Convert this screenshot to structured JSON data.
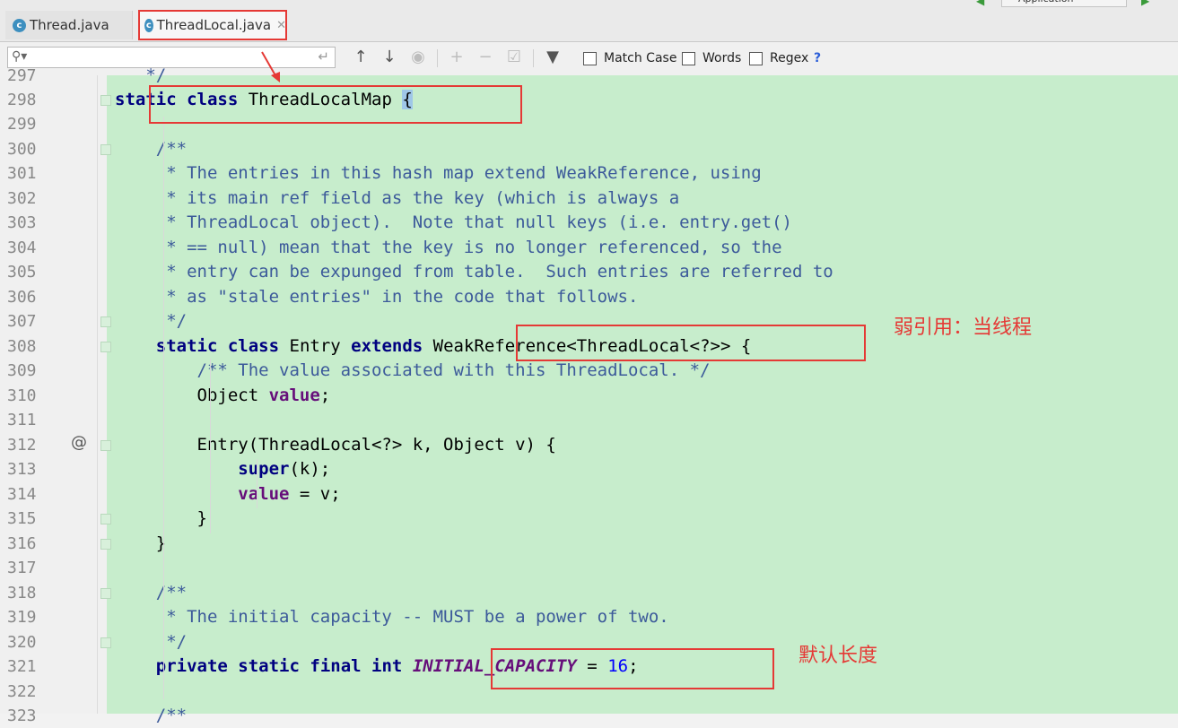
{
  "tabs": [
    {
      "label": "Thread.java",
      "icon": "c"
    },
    {
      "label": "ThreadLocal.java",
      "icon": "c"
    }
  ],
  "top_strip": {
    "label": "Application"
  },
  "find_bar": {
    "search_value": "",
    "options": [
      {
        "label": "Match Case",
        "checked": false
      },
      {
        "label": "Words",
        "checked": false
      },
      {
        "label": "Regex",
        "checked": false
      }
    ],
    "help": "?"
  },
  "code_lines": [
    {
      "n": "297",
      "text": "   */"
    },
    {
      "n": "298",
      "text": "static class ThreadLocalMap {"
    },
    {
      "n": "299",
      "text": ""
    },
    {
      "n": "300",
      "text": "    /**"
    },
    {
      "n": "301",
      "text": "     * The entries in this hash map extend WeakReference, using"
    },
    {
      "n": "302",
      "text": "     * its main ref field as the key (which is always a"
    },
    {
      "n": "303",
      "text": "     * ThreadLocal object).  Note that null keys (i.e. entry.get()"
    },
    {
      "n": "304",
      "text": "     * == null) mean that the key is no longer referenced, so the"
    },
    {
      "n": "305",
      "text": "     * entry can be expunged from table.  Such entries are referred to"
    },
    {
      "n": "306",
      "text": "     * as \"stale entries\" in the code that follows."
    },
    {
      "n": "307",
      "text": "     */"
    },
    {
      "n": "308",
      "text": "    static class Entry extends WeakReference<ThreadLocal<?>> {"
    },
    {
      "n": "309",
      "text": "        /** The value associated with this ThreadLocal. */"
    },
    {
      "n": "310",
      "text": "        Object value;"
    },
    {
      "n": "311",
      "text": ""
    },
    {
      "n": "312",
      "text": "        Entry(ThreadLocal<?> k, Object v) {"
    },
    {
      "n": "313",
      "text": "            super(k);"
    },
    {
      "n": "314",
      "text": "            value = v;"
    },
    {
      "n": "315",
      "text": "        }"
    },
    {
      "n": "316",
      "text": "    }"
    },
    {
      "n": "317",
      "text": ""
    },
    {
      "n": "318",
      "text": "    /**"
    },
    {
      "n": "319",
      "text": "     * The initial capacity -- MUST be a power of two."
    },
    {
      "n": "320",
      "text": "     */"
    },
    {
      "n": "321",
      "text": "    private static final int INITIAL_CAPACITY = 16;"
    },
    {
      "n": "322",
      "text": ""
    },
    {
      "n": "323",
      "text": "    /**"
    }
  ],
  "gutter_marker": "@",
  "annotations": {
    "weak_ref_note": "弱引用：当线程",
    "capacity_note": "默认长度"
  },
  "colors": {
    "editor_bg": "#c7edcc",
    "keyword": "#000080",
    "comment": "#3c5a9a",
    "field": "#660e7a",
    "number": "#0000ff",
    "annotation": "#e53935"
  }
}
